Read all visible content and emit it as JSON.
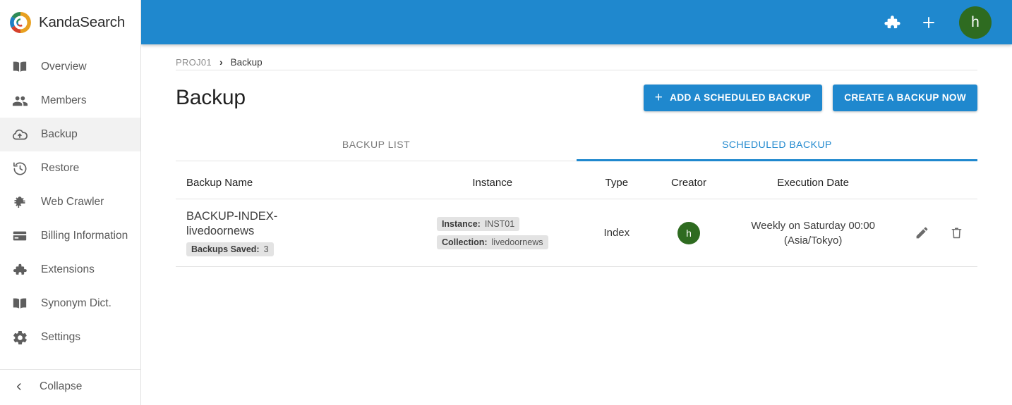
{
  "brand": {
    "name": "KandaSearch",
    "logo_icon": "kandasearch-swirl-logo"
  },
  "sidebar": {
    "items": [
      {
        "label": "Overview",
        "icon": "book-icon",
        "active": false
      },
      {
        "label": "Members",
        "icon": "people-icon",
        "active": false
      },
      {
        "label": "Backup",
        "icon": "cloud-upload-icon",
        "active": true
      },
      {
        "label": "Restore",
        "icon": "history-icon",
        "active": false
      },
      {
        "label": "Web Crawler",
        "icon": "bug-icon",
        "active": false
      },
      {
        "label": "Billing Information",
        "icon": "credit-card-icon",
        "active": false
      },
      {
        "label": "Extensions",
        "icon": "puzzle-icon",
        "active": false
      },
      {
        "label": "Synonym Dict.",
        "icon": "book-icon",
        "active": false
      },
      {
        "label": "Settings",
        "icon": "gear-icon",
        "active": false
      }
    ],
    "collapse_label": "Collapse",
    "collapse_icon": "chevron-left-icon"
  },
  "topbar": {
    "background": "#1f88ce",
    "extensions_icon": "puzzle-icon",
    "add_icon": "plus-icon",
    "avatar_initial": "h",
    "avatar_color": "#2e6b20"
  },
  "breadcrumb": {
    "project": "PROJ01",
    "separator": "›",
    "current": "Backup"
  },
  "page": {
    "title": "Backup"
  },
  "buttons": {
    "add_scheduled": {
      "label": "ADD A SCHEDULED BACKUP",
      "icon": "plus-icon"
    },
    "create_now": {
      "label": "CREATE A BACKUP NOW"
    }
  },
  "tabs": [
    {
      "label": "BACKUP LIST",
      "active": false
    },
    {
      "label": "SCHEDULED BACKUP",
      "active": true
    }
  ],
  "table": {
    "headers": [
      "Backup Name",
      "Instance",
      "Type",
      "Creator",
      "Execution Date",
      ""
    ],
    "rows": [
      {
        "backup_name": "BACKUP-INDEX-livedoornews",
        "saved_key": "Backups Saved:",
        "saved_value": "3",
        "instance_key": "Instance:",
        "instance_value": "INST01",
        "collection_key": "Collection:",
        "collection_value": "livedoornews",
        "type": "Index",
        "creator_initial": "h",
        "creator_color": "#2e6b20",
        "execution_date_line1": "Weekly on Saturday 00:00",
        "execution_date_line2": "(Asia/Tokyo)",
        "edit_icon": "pencil-icon",
        "delete_icon": "trash-icon"
      }
    ]
  },
  "colors": {
    "accent": "#1f88ce",
    "active_nav_bg": "#f2f2f2",
    "chip_bg": "#e3e3e3"
  }
}
